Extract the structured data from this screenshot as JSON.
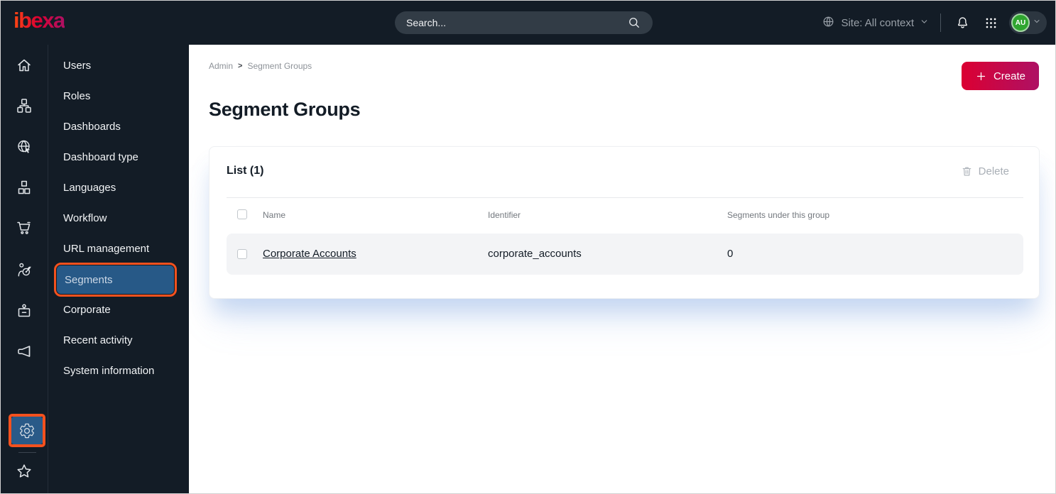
{
  "topbar": {
    "logo_text": "ibexa",
    "search_placeholder": "Search...",
    "site_context_label": "Site: All context",
    "avatar_initials": "AU",
    "icons": [
      "globe-icon",
      "chevron-down-icon",
      "bell-icon",
      "app-grid-icon",
      "search-icon"
    ]
  },
  "icon_rail": {
    "items": [
      {
        "icon": "home-icon"
      },
      {
        "icon": "content-tree-icon"
      },
      {
        "icon": "site-icon"
      },
      {
        "icon": "products-icon"
      },
      {
        "icon": "cart-icon"
      },
      {
        "icon": "personalization-icon"
      },
      {
        "icon": "corporate-badge-icon"
      },
      {
        "icon": "announcement-icon"
      }
    ],
    "bottom_items": [
      {
        "icon": "gear-icon",
        "active": true,
        "highlighted": true
      },
      {
        "icon": "star-icon"
      }
    ]
  },
  "menu": {
    "items": [
      {
        "label": "Users"
      },
      {
        "label": "Roles"
      },
      {
        "label": "Dashboards"
      },
      {
        "label": "Dashboard type"
      },
      {
        "label": "Languages"
      },
      {
        "label": "Workflow"
      },
      {
        "label": "URL management"
      },
      {
        "label": "Segments",
        "active": true,
        "highlighted": true
      },
      {
        "label": "Corporate"
      },
      {
        "label": "Recent activity"
      },
      {
        "label": "System information"
      }
    ]
  },
  "breadcrumb": {
    "items": [
      "Admin",
      "Segment Groups"
    ],
    "separator": ">"
  },
  "page": {
    "title": "Segment Groups",
    "create_label": "Create"
  },
  "card": {
    "title": "List (1)",
    "delete_label": "Delete",
    "table": {
      "columns": [
        "Name",
        "Identifier",
        "Segments under this group"
      ],
      "rows": [
        {
          "name": "Corporate Accounts",
          "identifier": "corporate_accounts",
          "segments": "0"
        }
      ]
    }
  },
  "colors": {
    "topbar_bg": "#131c26",
    "accent_orange": "#f4511e",
    "active_blue": "#275987",
    "brand_gradient_start": "#db0032",
    "brand_gradient_end": "#ae1164",
    "avatar_green": "#2fa52f"
  }
}
